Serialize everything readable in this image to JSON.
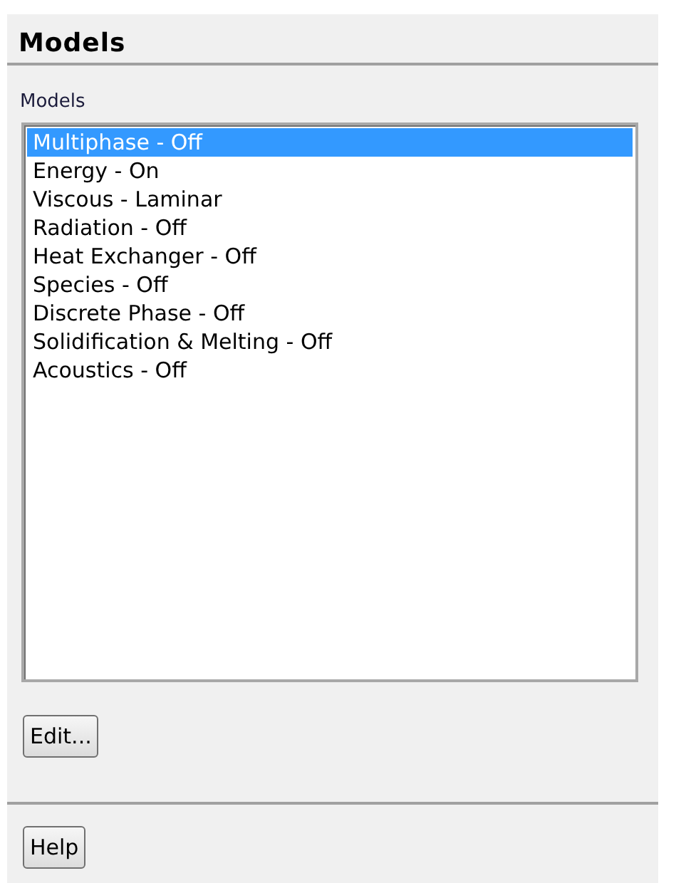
{
  "panel": {
    "title": "Models"
  },
  "models_list": {
    "label": "Models",
    "items": [
      {
        "text": "Multiphase - Off",
        "selected": true
      },
      {
        "text": "Energy - On",
        "selected": false
      },
      {
        "text": "Viscous - Laminar",
        "selected": false
      },
      {
        "text": "Radiation - Off",
        "selected": false
      },
      {
        "text": "Heat Exchanger - Off",
        "selected": false
      },
      {
        "text": "Species - Off",
        "selected": false
      },
      {
        "text": "Discrete Phase - Off",
        "selected": false
      },
      {
        "text": "Solidification & Melting - Off",
        "selected": false
      },
      {
        "text": "Acoustics - Off",
        "selected": false
      }
    ]
  },
  "buttons": [
    "Edit...",
    "Help"
  ]
}
